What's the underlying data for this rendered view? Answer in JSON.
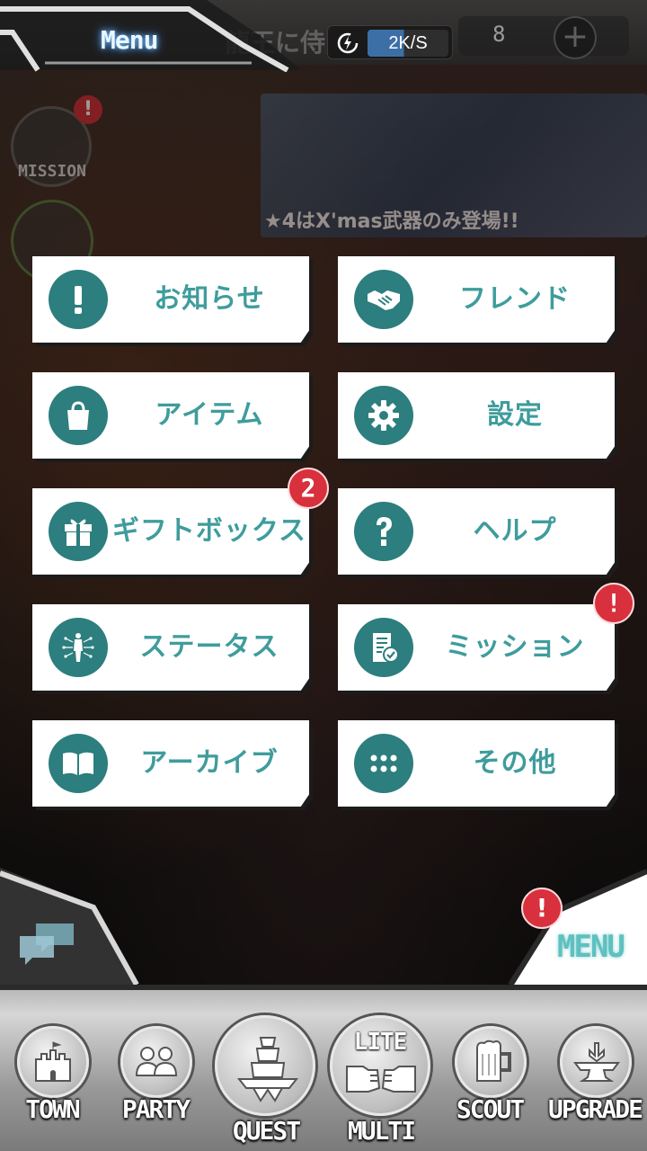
{
  "header": {
    "menu_title": "Menu",
    "background_title": "龍王に侍",
    "speed": "2K/S",
    "currency_count": "8",
    "add_label": "+"
  },
  "side": {
    "mission_label": "MISSION",
    "mission_badge": "!"
  },
  "banner": {
    "text": "★4はX'mas武器のみ登場!!"
  },
  "menu": {
    "items": [
      {
        "label": "お知らせ",
        "icon": "exclamation-icon"
      },
      {
        "label": "フレンド",
        "icon": "handshake-icon"
      },
      {
        "label": "アイテム",
        "icon": "bag-icon"
      },
      {
        "label": "設定",
        "icon": "gear-icon"
      },
      {
        "label": "ギフトボックス",
        "icon": "gift-icon",
        "badge": "2"
      },
      {
        "label": "ヘルプ",
        "icon": "question-icon"
      },
      {
        "label": "ステータス",
        "icon": "body-status-icon"
      },
      {
        "label": "ミッション",
        "icon": "mission-document-icon",
        "badge": "!"
      },
      {
        "label": "アーカイブ",
        "icon": "book-icon"
      },
      {
        "label": "その他",
        "icon": "dots-grid-icon"
      }
    ]
  },
  "corner": {
    "menu_label": "MENU",
    "menu_badge": "!"
  },
  "nav": {
    "items": [
      {
        "label": "TOWN"
      },
      {
        "label": "PARTY"
      },
      {
        "label": "QUEST"
      },
      {
        "label": "MULTI",
        "sub": "LITE"
      },
      {
        "label": "SCOUT"
      },
      {
        "label": "UPGRADE"
      }
    ]
  },
  "colors": {
    "accent_teal": "#2d7e7e",
    "label_teal": "#3f9c9c",
    "badge_red": "#d8303c"
  }
}
